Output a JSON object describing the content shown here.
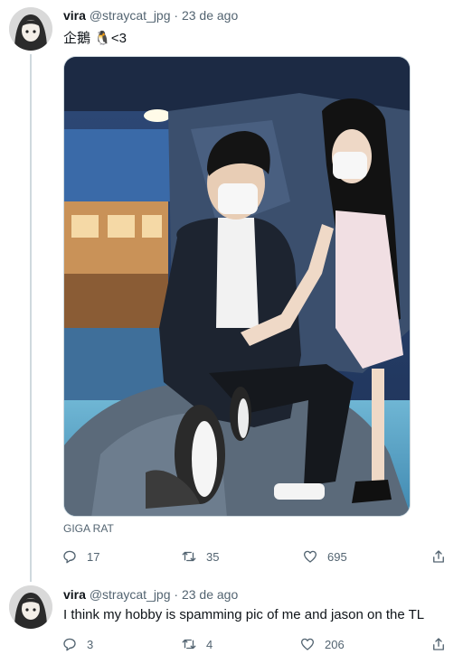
{
  "tweets": [
    {
      "name": "vira",
      "handle": "@straycat_jpg",
      "separator": "·",
      "date": "23 de ago",
      "text": "企鵝 🐧<3",
      "media_caption": "GIGA RAT",
      "replies": "17",
      "retweets": "35",
      "likes": "695"
    },
    {
      "name": "vira",
      "handle": "@straycat_jpg",
      "separator": "·",
      "date": "23 de ago",
      "text": "I think my hobby is spamming pic of me and jason on the TL",
      "replies": "3",
      "retweets": "4",
      "likes": "206"
    }
  ],
  "icons": {
    "reply": "reply-icon",
    "retweet": "retweet-icon",
    "like": "heart-icon",
    "share": "share-icon"
  },
  "colors": {
    "text": "#0f1419",
    "secondary": "#536471",
    "thread_line": "#cfd9de"
  }
}
